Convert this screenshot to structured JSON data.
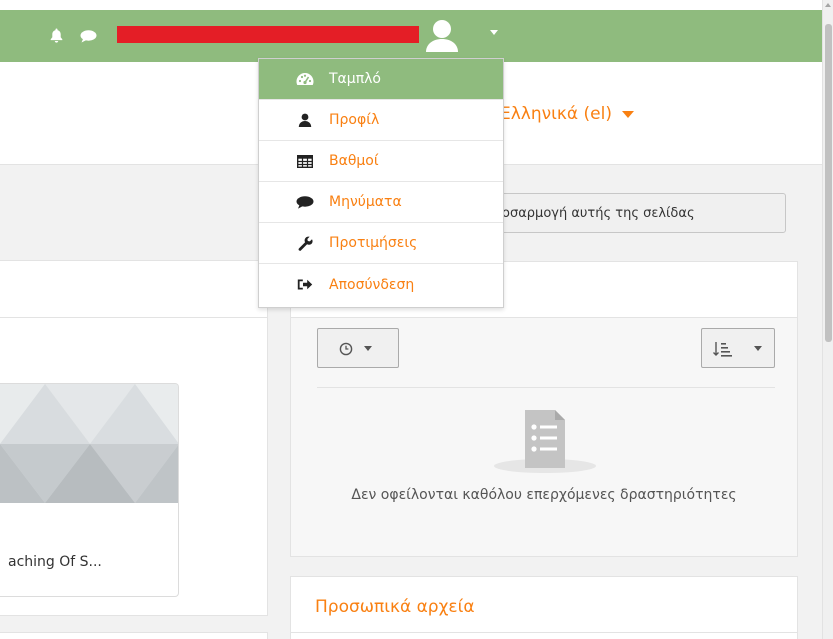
{
  "navbar": {
    "bell_icon": "bell-icon",
    "messages_icon": "chat-bubble-icon",
    "user_icon": "user-avatar-icon",
    "bg_color": "#8fbb7e",
    "redaction_color": "#e41e26"
  },
  "header": {
    "language_label": "Ελληνικά (el)"
  },
  "customise_button_label": "Προσαρμογή αυτής της σελίδας",
  "user_menu": {
    "items": [
      {
        "label": "Ταμπλό",
        "icon": "dashboard-icon",
        "active": true
      },
      {
        "label": "Προφίλ",
        "icon": "user-icon",
        "active": false
      },
      {
        "label": "Βαθμοί",
        "icon": "table-icon",
        "active": false
      },
      {
        "label": "Μηνύματα",
        "icon": "chat-bubble-icon",
        "active": false
      },
      {
        "label": "Προτιμήσεις",
        "icon": "wrench-icon",
        "active": false
      },
      {
        "label": "Αποσύνδεση",
        "icon": "sign-out-icon",
        "active": false
      }
    ]
  },
  "course_card": {
    "title": "aching Of S..."
  },
  "timeline": {
    "filter_icon": "clock-icon",
    "sort_icon": "sort-amount-icon",
    "empty_message": "Δεν οφείλονται καθόλου επερχόμενες δραστηριότητες"
  },
  "private_files": {
    "title": "Προσωπικά αρχεία"
  },
  "colors": {
    "accent": "#f98012",
    "active_menu": "#8fbb7e"
  }
}
